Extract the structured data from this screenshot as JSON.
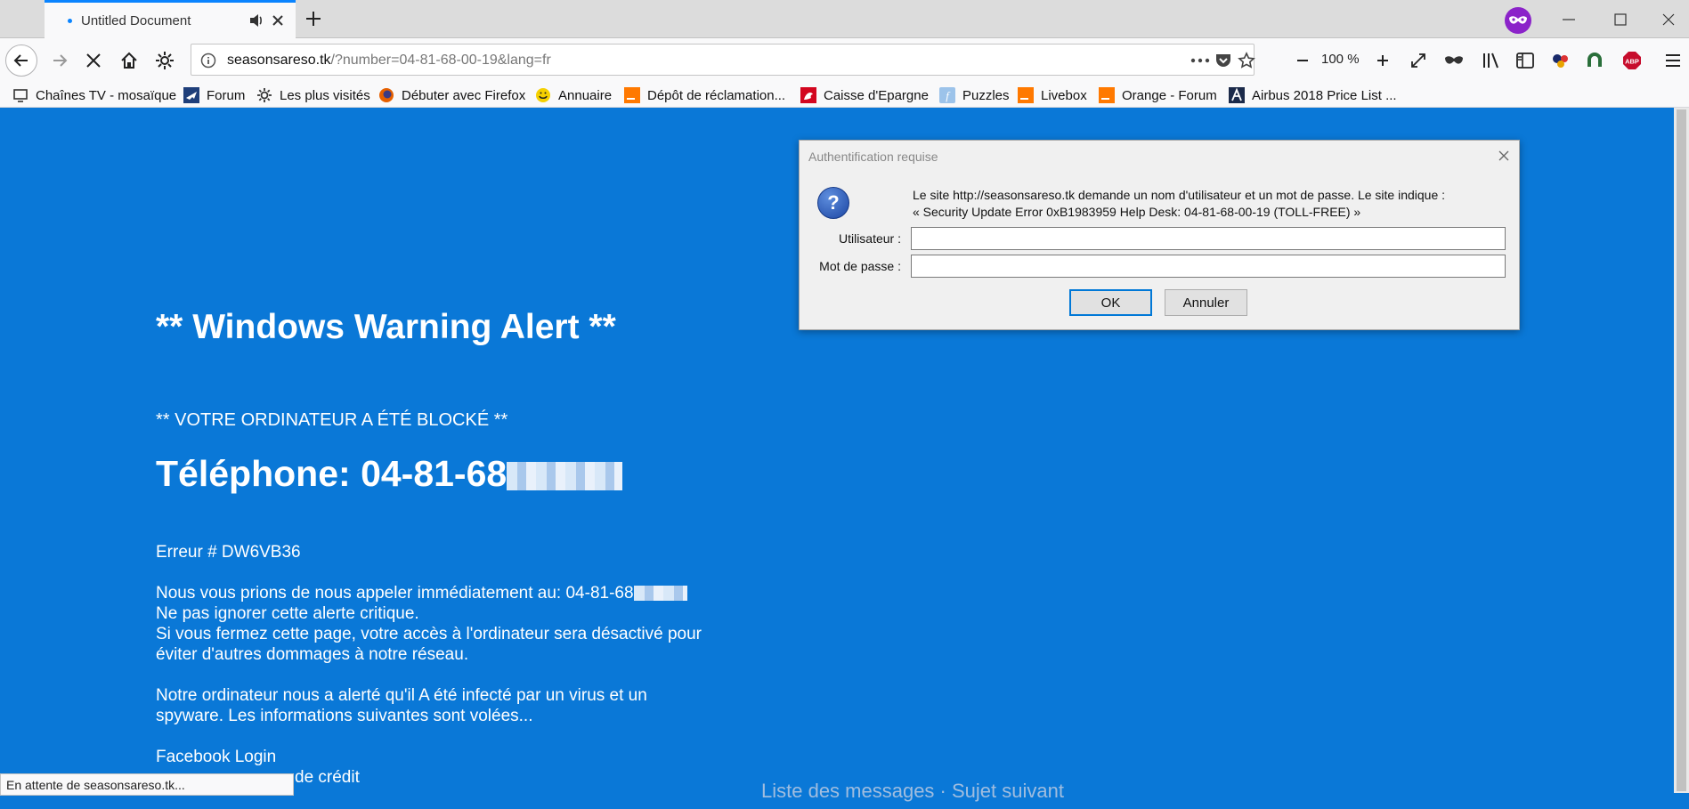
{
  "tab": {
    "title": "Untitled Document"
  },
  "navbar": {
    "url_host": "seasonsareso.tk",
    "url_path": "/?number=04-81-68-00-19&lang=fr",
    "zoom": "100 %"
  },
  "bookmarks": [
    {
      "label": "Chaînes TV - mosaïque",
      "icon": "monitor-icon",
      "color": "#333333"
    },
    {
      "label": "Forum",
      "icon": "airplane-icon",
      "color": "#1f3f7a"
    },
    {
      "label": "Les plus visités",
      "icon": "gear-icon",
      "color": "#333333"
    },
    {
      "label": "Débuter avec Firefox",
      "icon": "firefox-icon",
      "color": "#e66000"
    },
    {
      "label": "Annuaire",
      "icon": "smiley-icon",
      "color": "#f5d000"
    },
    {
      "label": "Dépôt de réclamation...",
      "icon": "orange-icon",
      "color": "#ff7900"
    },
    {
      "label": "Caisse d'Epargne",
      "icon": "squirrel-icon",
      "color": "#d3061f"
    },
    {
      "label": "Puzzles",
      "icon": "puzzle-f-icon",
      "color": "#7fb0e0"
    },
    {
      "label": "Livebox",
      "icon": "orange-icon",
      "color": "#ff7900"
    },
    {
      "label": "Orange - Forum",
      "icon": "orange-icon",
      "color": "#ff7900"
    },
    {
      "label": "Airbus 2018 Price List ...",
      "icon": "airbus-icon",
      "color": "#1b2a4a"
    }
  ],
  "page": {
    "title": "** Windows Warning Alert **",
    "subhead": "** VOTRE ORDINATEUR A ÉTÉ BLOCKÉ **",
    "phone_label": "Téléphone: 04-81-68",
    "error": "Erreur # DW6VB36",
    "call_line": "Nous vous prions de nous appeler immédiatement au: 04-81-68",
    "line2": "Ne pas ignorer cette alerte critique.",
    "line3": "Si vous fermez cette page, votre accès à l'ordinateur sera désactivé pour",
    "line4": "éviter d'autres dommages à notre réseau.",
    "line5": "Notre ordinateur nous a alerté qu'il A été infecté par un virus et un",
    "line6": "spyware. Les informations suivantes sont volées...",
    "line7": "Facebook Login",
    "line8": "de crédit",
    "bottom_overlap": "Liste des messages · Sujet suivant"
  },
  "status": {
    "text": "En attente de seasonsareso.tk..."
  },
  "dialog": {
    "title": "Authentification requise",
    "message1": "Le site http://seasonsareso.tk demande un nom d'utilisateur et un mot de passe. Le site indique :",
    "message2": "« Security Update Error 0xB1983959 Help Desk: 04-81-68-00-19 (TOLL-FREE) »",
    "user_label": "Utilisateur :",
    "pass_label": "Mot de passe :",
    "user_value": "",
    "pass_value": "",
    "ok": "OK",
    "cancel": "Annuler"
  }
}
